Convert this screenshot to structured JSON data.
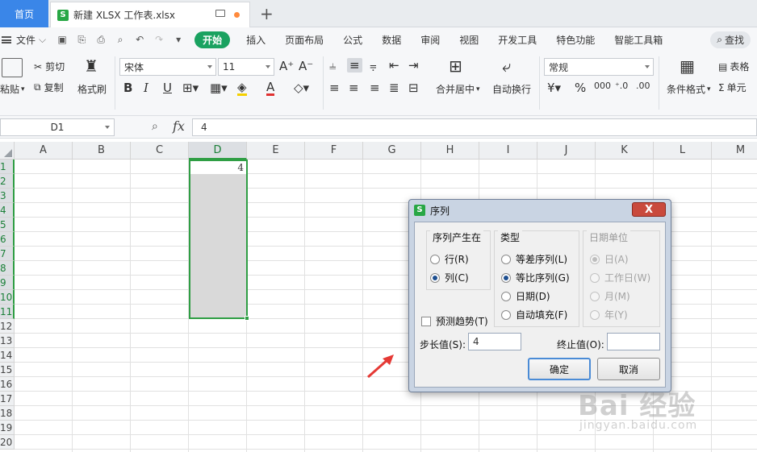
{
  "tabs": {
    "home_label": "首页",
    "file_badge": "S",
    "file_name": "新建 XLSX 工作表.xlsx",
    "new_tab_symbol": "+"
  },
  "menu": {
    "file_label": "文件",
    "items": [
      "开始",
      "插入",
      "页面布局",
      "公式",
      "数据",
      "审阅",
      "视图",
      "开发工具",
      "特色功能",
      "智能工具箱"
    ],
    "search_label": "查找"
  },
  "ribbon": {
    "paste": "粘贴",
    "cut": "剪切",
    "copy": "复制",
    "format_painter": "格式刷",
    "font_name": "宋体",
    "font_size": "11",
    "merge_center": "合并居中",
    "wrap_text": "自动换行",
    "number_format": "常规",
    "conditional_format": "条件格式",
    "table_style": "表格",
    "cell_label": "单元"
  },
  "formula_bar": {
    "cell_ref": "D1",
    "fx_label": "fx",
    "value": "4"
  },
  "grid": {
    "columns": [
      "A",
      "B",
      "C",
      "D",
      "E",
      "F",
      "G",
      "H",
      "I",
      "J",
      "K",
      "L",
      "M"
    ],
    "rows": [
      "1",
      "2",
      "3",
      "4",
      "5",
      "6",
      "7",
      "8",
      "9",
      "10",
      "11",
      "12",
      "13",
      "14",
      "15",
      "16",
      "17",
      "18",
      "19",
      "20"
    ],
    "active_column": "D",
    "d1_value": "4"
  },
  "dialog": {
    "badge": "S",
    "title": "序列",
    "close_symbol": "X",
    "series_in": {
      "title": "序列产生在",
      "rows": "行(R)",
      "columns": "列(C)",
      "selected": "columns"
    },
    "type": {
      "title": "类型",
      "linear": "等差序列(L)",
      "growth": "等比序列(G)",
      "date": "日期(D)",
      "autofill": "自动填充(F)",
      "selected": "growth"
    },
    "date_unit": {
      "title": "日期单位",
      "day": "日(A)",
      "weekday": "工作日(W)",
      "month": "月(M)",
      "year": "年(Y)"
    },
    "trend_label": "预测趋势(T)",
    "step_label": "步长值(S):",
    "step_value": "4",
    "stop_label": "终止值(O):",
    "stop_value": "",
    "ok_label": "确定",
    "cancel_label": "取消"
  },
  "watermark": {
    "main": "Bai 经验",
    "sub": "jingyan.baidu.com"
  },
  "colors": {
    "accent_green": "#1aa260",
    "selection_green": "#2f9e44",
    "home_tab_blue": "#3a86e8",
    "arrow_red": "#e53935"
  }
}
